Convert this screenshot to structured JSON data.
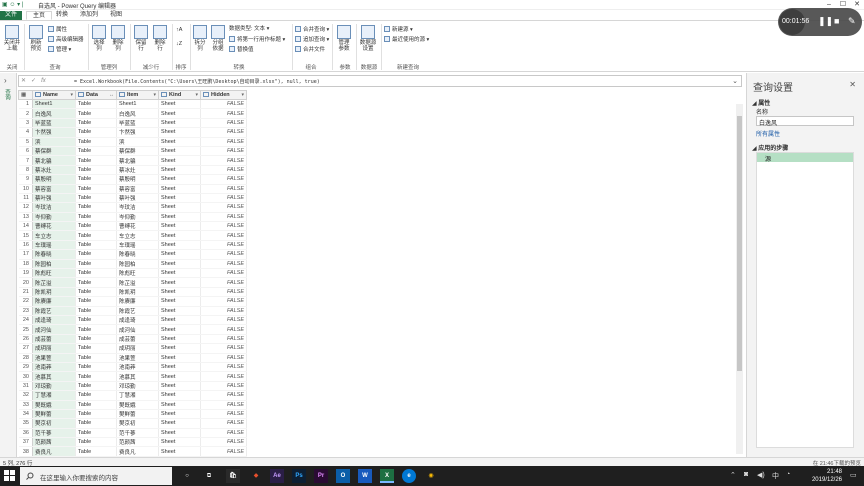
{
  "window": {
    "title": "自选风 - Power Query 编辑器",
    "recording_time": "00:01:56"
  },
  "ribbon_tabs": [
    "文件",
    "主页",
    "转换",
    "添加列",
    "视图"
  ],
  "ribbon": {
    "close_load": "关闭并\n上载",
    "refresh": "刷新\n预览",
    "properties": "属性",
    "advanced_editor": "高级编辑器",
    "manage": "管理",
    "choose_cols": "选择\n列",
    "remove_cols": "删除\n列",
    "keep_rows": "保留\n行",
    "remove_rows": "删除\n行",
    "split_col": "拆分\n列",
    "group_by": "分组\n依据",
    "data_type": "数据类型: 文本",
    "first_row_header": "将第一行用作标题",
    "replace_values": "替换值",
    "merge_queries": "合并查询",
    "append_queries": "追加查询",
    "combine_files": "合并文件",
    "manage_params": "管理\n参数",
    "ds_settings": "数据源\n设置",
    "new_source": "新建源",
    "recent_sources": "最近使用的源",
    "groups": [
      "关闭",
      "查询",
      "管理列",
      "减少行",
      "排序",
      "转换",
      "组合",
      "参数",
      "数据源",
      "新建查询"
    ]
  },
  "left_nav_label": "查询",
  "formula": "= Excel.Workbook(File.Contents(\"C:\\Users\\王旺鹏\\Desktop\\自动目录.xlsx\"), null, true)",
  "columns": [
    "Name",
    "Data",
    "Item",
    "Kind",
    "Hidden"
  ],
  "rows": [
    [
      "Sheet1",
      "Table",
      "Sheet1",
      "Sheet",
      "FALSE"
    ],
    [
      "白逸风",
      "Table",
      "白逸风",
      "Sheet",
      "FALSE"
    ],
    [
      "毕蓝蓝",
      "Table",
      "毕蓝蓝",
      "Sheet",
      "FALSE"
    ],
    [
      "卞然强",
      "Table",
      "卞然强",
      "Sheet",
      "FALSE"
    ],
    [
      "滨",
      "Table",
      "滨",
      "Sheet",
      "FALSE"
    ],
    [
      "蔡保群",
      "Table",
      "蔡保群",
      "Sheet",
      "FALSE"
    ],
    [
      "蔡北骗",
      "Table",
      "蔡北骗",
      "Sheet",
      "FALSE"
    ],
    [
      "蔡冰灶",
      "Table",
      "蔡冰灶",
      "Sheet",
      "FALSE"
    ],
    [
      "蔡殷明",
      "Table",
      "蔡殷明",
      "Sheet",
      "FALSE"
    ],
    [
      "蔡容富",
      "Table",
      "蔡容富",
      "Sheet",
      "FALSE"
    ],
    [
      "蔡叶强",
      "Table",
      "蔡叶强",
      "Sheet",
      "FALSE"
    ],
    [
      "岑玟洁",
      "Table",
      "岑玟洁",
      "Sheet",
      "FALSE"
    ],
    [
      "岑仰勤",
      "Table",
      "岑仰勤",
      "Sheet",
      "FALSE"
    ],
    [
      "曹缚花",
      "Table",
      "曹缚花",
      "Sheet",
      "FALSE"
    ],
    [
      "车立志",
      "Table",
      "车立志",
      "Sheet",
      "FALSE"
    ],
    [
      "车璞瑶",
      "Table",
      "车璞瑶",
      "Sheet",
      "FALSE"
    ],
    [
      "陈春晓",
      "Table",
      "陈春晓",
      "Sheet",
      "FALSE"
    ],
    [
      "陈园柏",
      "Table",
      "陈园柏",
      "Sheet",
      "FALSE"
    ],
    [
      "陈彪旺",
      "Table",
      "陈彪旺",
      "Sheet",
      "FALSE"
    ],
    [
      "陈芷溢",
      "Table",
      "陈芷溢",
      "Sheet",
      "FALSE"
    ],
    [
      "陈凯玥",
      "Table",
      "陈凯玥",
      "Sheet",
      "FALSE"
    ],
    [
      "陈赓廉",
      "Table",
      "陈赓廉",
      "Sheet",
      "FALSE"
    ],
    [
      "陈霞艺",
      "Table",
      "陈霞艺",
      "Sheet",
      "FALSE"
    ],
    [
      "成逢琦",
      "Table",
      "成逢琦",
      "Sheet",
      "FALSE"
    ],
    [
      "成河仙",
      "Table",
      "成河仙",
      "Sheet",
      "FALSE"
    ],
    [
      "成芸蕾",
      "Table",
      "成芸蕾",
      "Sheet",
      "FALSE"
    ],
    [
      "成玥丽",
      "Table",
      "成玥丽",
      "Sheet",
      "FALSE"
    ],
    [
      "池果萱",
      "Table",
      "池果萱",
      "Sheet",
      "FALSE"
    ],
    [
      "池南莽",
      "Table",
      "池南莽",
      "Sheet",
      "FALSE"
    ],
    [
      "池慕其",
      "Table",
      "池慕其",
      "Sheet",
      "FALSE"
    ],
    [
      "邓琼勤",
      "Table",
      "邓琼勤",
      "Sheet",
      "FALSE"
    ],
    [
      "丁慧湘",
      "Table",
      "丁慧湘",
      "Sheet",
      "FALSE"
    ],
    [
      "樊既娥",
      "Table",
      "樊既娥",
      "Sheet",
      "FALSE"
    ],
    [
      "樊鲜蕾",
      "Table",
      "樊鲜蕾",
      "Sheet",
      "FALSE"
    ],
    [
      "樊京初",
      "Table",
      "樊京初",
      "Sheet",
      "FALSE"
    ],
    [
      "范千蔘",
      "Table",
      "范千蔘",
      "Sheet",
      "FALSE"
    ],
    [
      "范颜茜",
      "Table",
      "范颜茜",
      "Sheet",
      "FALSE"
    ],
    [
      "费良凡",
      "Table",
      "费良凡",
      "Sheet",
      "FALSE"
    ]
  ],
  "query_settings": {
    "title": "查询设置",
    "properties_header": "属性",
    "name_label": "名称",
    "name_value": "白逸风",
    "all_properties": "所有属性",
    "applied_steps_header": "应用的步骤",
    "steps": [
      "源"
    ]
  },
  "status": {
    "left": "5 列, 276 行",
    "right": "在 21:46下载的预览"
  },
  "taskbar": {
    "search_placeholder": "在这里输入你要搜索的内容",
    "time": "21:48",
    "date": "2019/12/26"
  }
}
